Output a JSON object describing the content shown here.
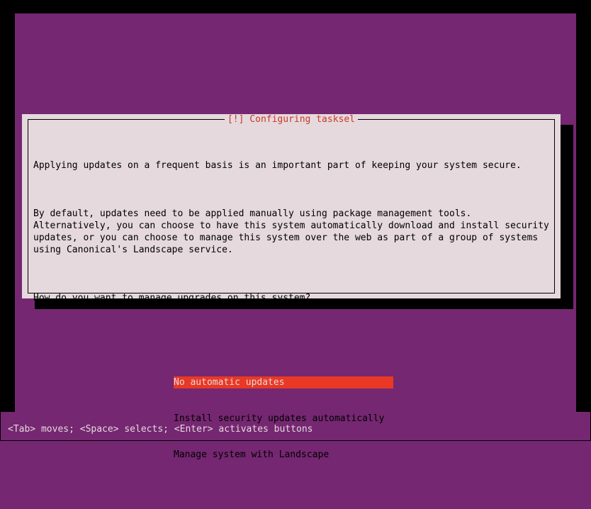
{
  "dialog": {
    "title": "[!] Configuring tasksel",
    "paragraph1": "Applying updates on a frequent basis is an important part of keeping your system secure.",
    "paragraph2": "By default, updates need to be applied manually using package management tools. Alternatively, you can choose to have this system automatically download and install security updates, or you can choose to manage this system over the web as part of a group of systems using Canonical's Landscape service.",
    "question": "How do you want to manage upgrades on this system?",
    "options": [
      "No automatic updates",
      "Install security updates automatically",
      "Manage system with Landscape"
    ],
    "selected_index": 0
  },
  "footer": "<Tab> moves; <Space> selects; <Enter> activates buttons"
}
